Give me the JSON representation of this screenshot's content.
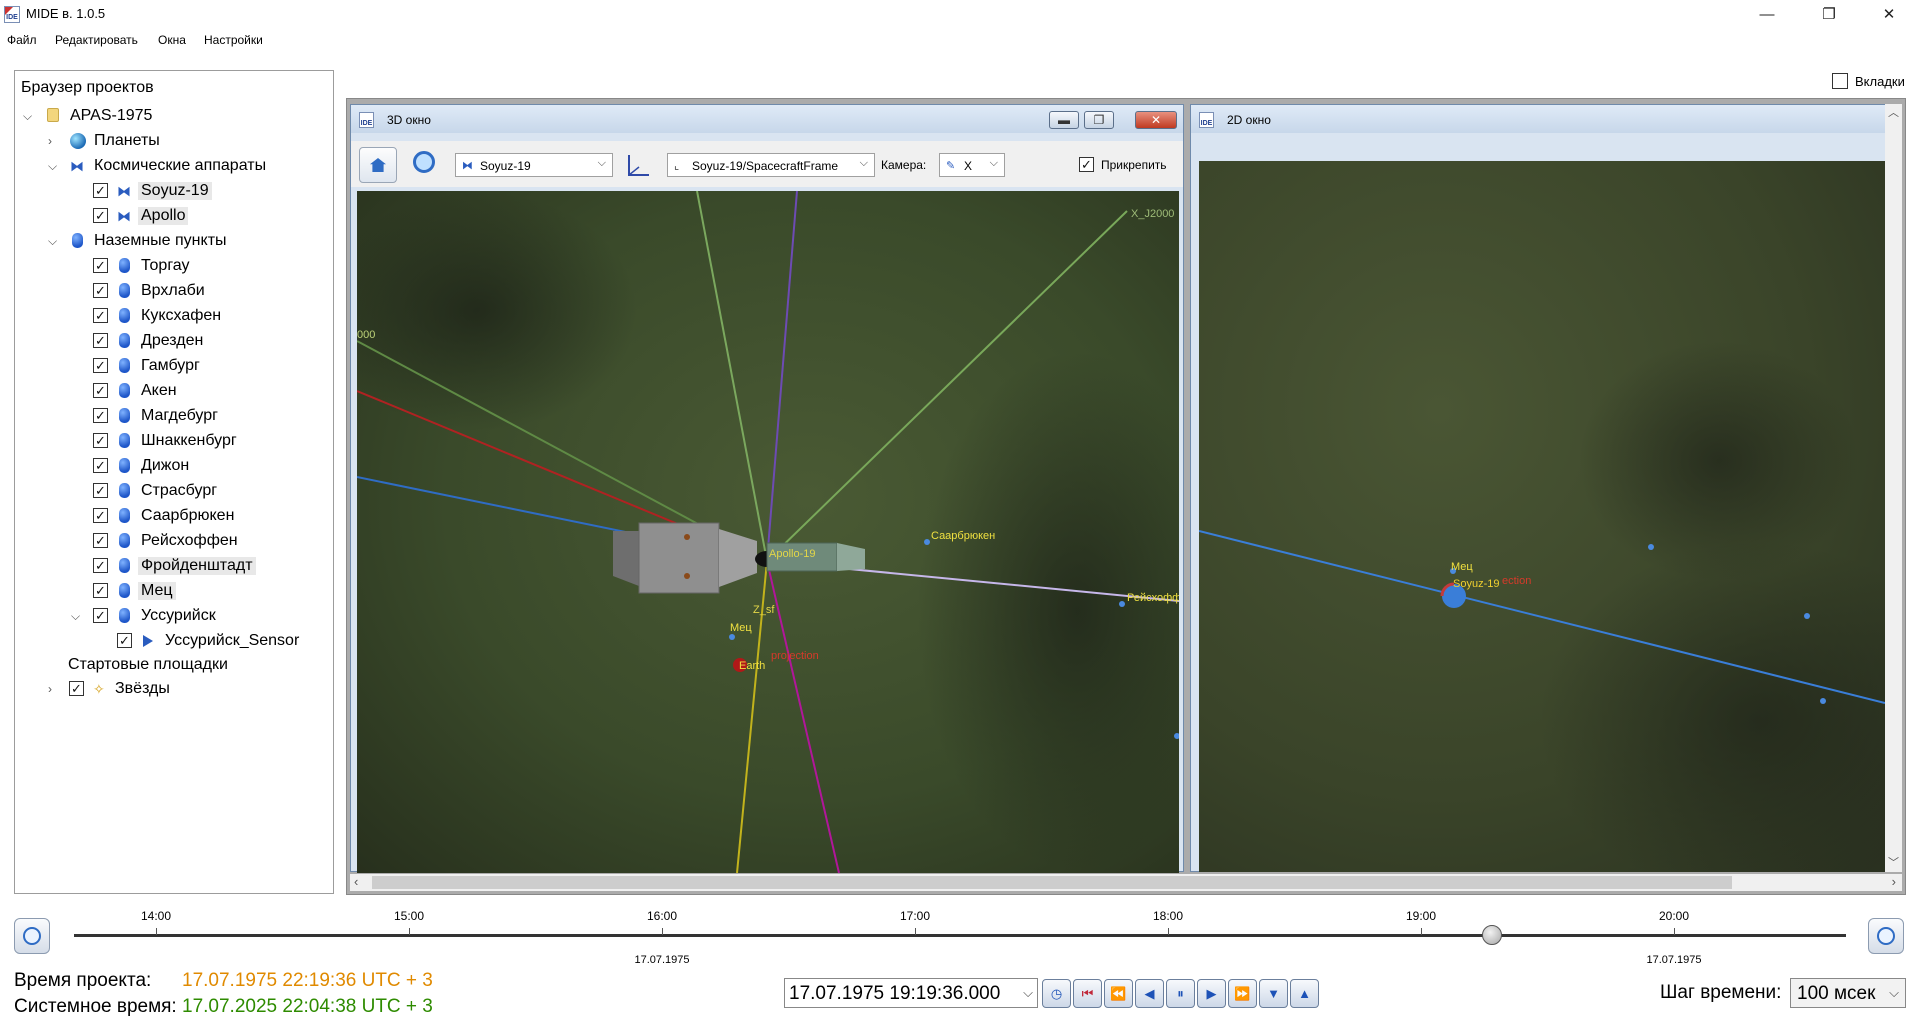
{
  "window": {
    "title": "MIDE в. 1.0.5",
    "icon_text": "IDE"
  },
  "menu": [
    "Файл",
    "Редактировать",
    "Окна",
    "Настройки"
  ],
  "browser": {
    "title": "Браузер проектов",
    "project": "APAS-1975",
    "planets": "Планеты",
    "spacecraft_group": "Космические аппараты",
    "spacecraft": [
      "Soyuz-19",
      "Apollo"
    ],
    "ground_group": "Наземные пункты",
    "ground": [
      "Торгау",
      "Врхлаби",
      "Куксхафен",
      "Дрезден",
      "Гамбург",
      "Акен",
      "Магдебург",
      "Шнаккенбург",
      "Дижон",
      "Страсбург",
      "Саарбрюкен",
      "Рейсхоффен",
      "Фройденштадт",
      "Мец",
      "Уссурийск"
    ],
    "sensor": "Уссурийск_Sensor",
    "launch_sites": "Стартовые площадки",
    "stars": "Звёзды"
  },
  "tabs_label": "Вкладки",
  "win3d": {
    "title": "3D окно",
    "object": "Soyuz-19",
    "frame": "Soyuz-19/SpacecraftFrame",
    "camera_label": "Камера:",
    "camera": "X",
    "attach_label": "Прикрепить",
    "scene_labels": {
      "x_j2000": "X_J2000",
      "j2000_left": "000",
      "apollo": "Apollo-19",
      "z_sf": "Z_sf",
      "saarbruecken": "Саарбрюкен",
      "reyshoffen": "Рейсхофф",
      "metz": "Мец",
      "earth": "Earth",
      "projection": "projection"
    }
  },
  "win2d": {
    "title": "2D окно",
    "scene_labels": {
      "metz": "Мец",
      "soyuz": "Soyuz-19",
      "projection": "ection"
    }
  },
  "timeline": {
    "times": [
      "14:00",
      "15:00",
      "16:00",
      "17:00",
      "18:00",
      "19:00",
      "20:00"
    ],
    "dates": [
      "17.07.1975",
      "17.07.1975"
    ],
    "position": 0.8
  },
  "status": {
    "project_time_label": "Время проекта:",
    "project_time": "17.07.1975 22:19:36 UTC + 3",
    "system_time_label": "Системное время:",
    "system_time": "17.07.2025 22:04:38 UTC + 3",
    "current_time": "17.07.1975 19:19:36.000",
    "step_label": "Шаг времени:",
    "step_value": "100 мсек"
  },
  "colors": {
    "project_time": "#e08a00",
    "system_time": "#2e8b00",
    "accent": "#2f6cc4"
  }
}
